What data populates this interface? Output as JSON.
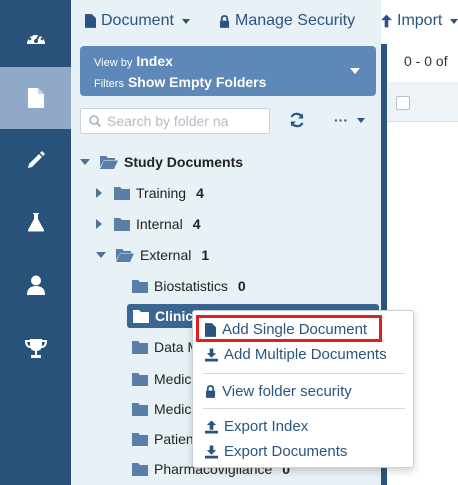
{
  "toolbar": {
    "document_label": "Document",
    "manage_security_label": "Manage Security",
    "import_label": "Import"
  },
  "viewby": {
    "view_by_prefix": "View by",
    "view_by_value": "Index",
    "filters_prefix": "Filters",
    "filters_value": "Show Empty Folders"
  },
  "search": {
    "placeholder": "Search by folder na"
  },
  "more_label": "···",
  "tree": {
    "root": "Study Documents",
    "training": {
      "label": "Training",
      "count": "4"
    },
    "internal": {
      "label": "Internal",
      "count": "4"
    },
    "external": {
      "label": "External",
      "count": "1"
    },
    "biostatistics": {
      "label": "Biostatistics",
      "count": "0"
    },
    "clinical": {
      "label": "Clinica"
    },
    "data": {
      "label": "Data M"
    },
    "medic1": {
      "label": "Medic"
    },
    "medic2": {
      "label": "Medic"
    },
    "patient": {
      "label": "Patien"
    },
    "pharma": {
      "label": "Pharmacovigilance",
      "count": "0"
    }
  },
  "grid": {
    "pager": "0 - 0 of"
  },
  "context_menu": {
    "add_single": "Add Single Document",
    "add_multiple": "Add Multiple Documents",
    "view_security": "View folder security",
    "export_index": "Export Index",
    "export_documents": "Export Documents"
  },
  "colors": {
    "rail": "#28527a",
    "accent": "#2b5580",
    "highlight": "#e01f1f"
  }
}
